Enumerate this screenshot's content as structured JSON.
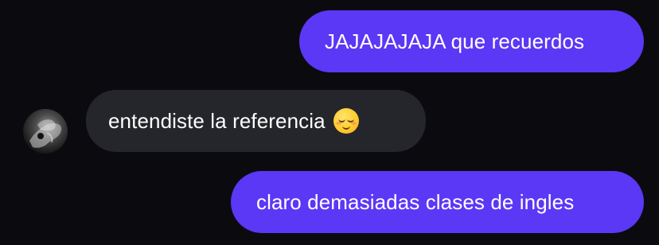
{
  "messages": [
    {
      "direction": "outgoing",
      "text": "JAJAJAJAJA que recuerdos"
    },
    {
      "direction": "incoming",
      "text": "entendiste la referencia",
      "emoji": "relieved-face"
    },
    {
      "direction": "outgoing",
      "text": "claro demasiadas clases de ingles"
    }
  ],
  "colors": {
    "background": "#0b0b0f",
    "outgoing_bubble": "#5a38f5",
    "incoming_bubble": "#25262b",
    "text": "#ffffff"
  },
  "contact": {
    "avatar_icon": "profile-photo"
  }
}
